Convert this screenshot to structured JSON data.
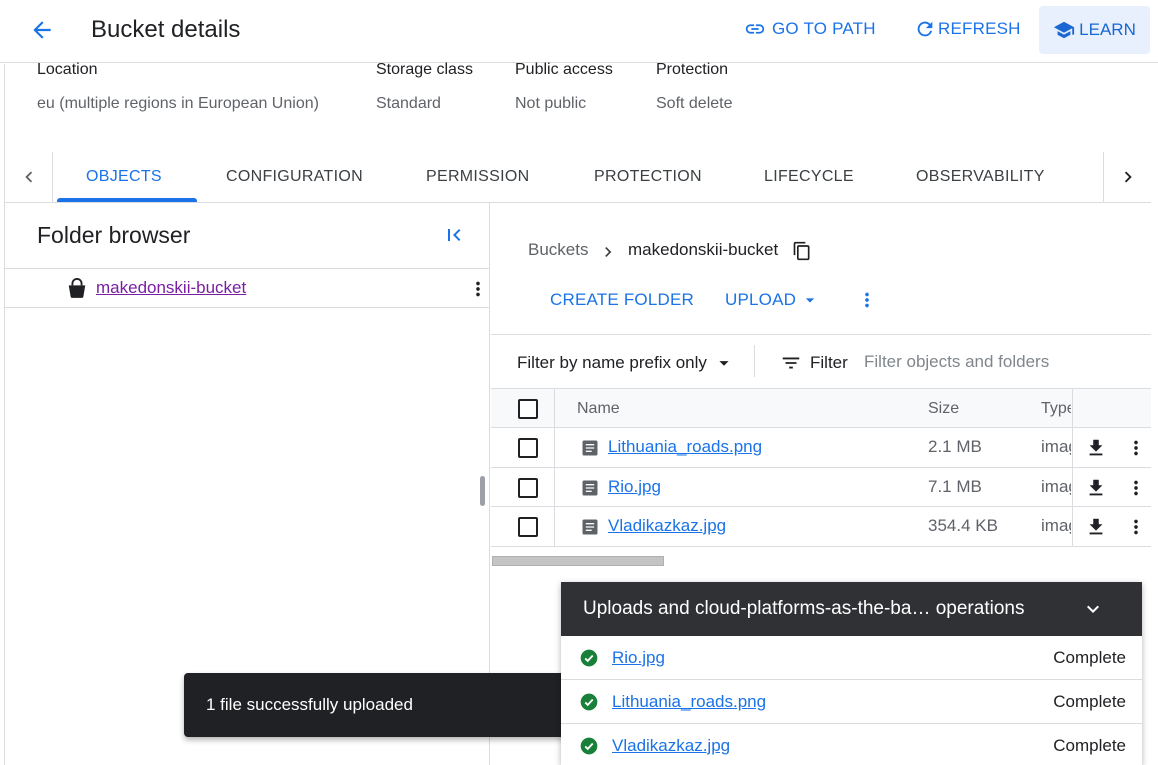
{
  "header": {
    "title": "Bucket details",
    "go_to_path": "GO TO PATH",
    "refresh": "REFRESH",
    "learn": "LEARN"
  },
  "info": [
    {
      "label": "Location",
      "value": "eu (multiple regions in European Union)"
    },
    {
      "label": "Storage class",
      "value": "Standard"
    },
    {
      "label": "Public access",
      "value": "Not public"
    },
    {
      "label": "Protection",
      "value": "Soft delete"
    }
  ],
  "tabs": [
    "OBJECTS",
    "CONFIGURATION",
    "PERMISSION",
    "PROTECTION",
    "LIFECYCLE",
    "OBSERVABILITY"
  ],
  "active_tab": "OBJECTS",
  "folder_browser": {
    "title": "Folder browser",
    "bucket": "makedonskii-bucket"
  },
  "breadcrumb": {
    "root": "Buckets",
    "bucket": "makedonskii-bucket"
  },
  "actions": {
    "create_folder": "CREATE FOLDER",
    "upload": "UPLOAD"
  },
  "filter": {
    "prefix_mode": "Filter by name prefix only",
    "label": "Filter",
    "placeholder": "Filter objects and folders"
  },
  "table": {
    "columns": [
      "Name",
      "Size",
      "Type"
    ],
    "rows": [
      {
        "name": "Lithuania_roads.png",
        "size": "2.1 MB",
        "type": "image/png"
      },
      {
        "name": "Rio.jpg",
        "size": "7.1 MB",
        "type": "image/jpeg"
      },
      {
        "name": "Vladikazkaz.jpg",
        "size": "354.4 KB",
        "type": "image/jpeg"
      }
    ]
  },
  "snackbar": "1 file successfully uploaded",
  "uploads": {
    "title": "Uploads and cloud-platforms-as-the-ba… operations",
    "items": [
      {
        "name": "Rio.jpg",
        "status": "Complete"
      },
      {
        "name": "Lithuania_roads.png",
        "status": "Complete"
      },
      {
        "name": "Vladikazkaz.jpg",
        "status": "Complete"
      }
    ]
  },
  "colors": {
    "accent": "#1a73e8",
    "success": "#188038",
    "visited_link": "#7b1fa2",
    "dark_panel": "#303134"
  }
}
